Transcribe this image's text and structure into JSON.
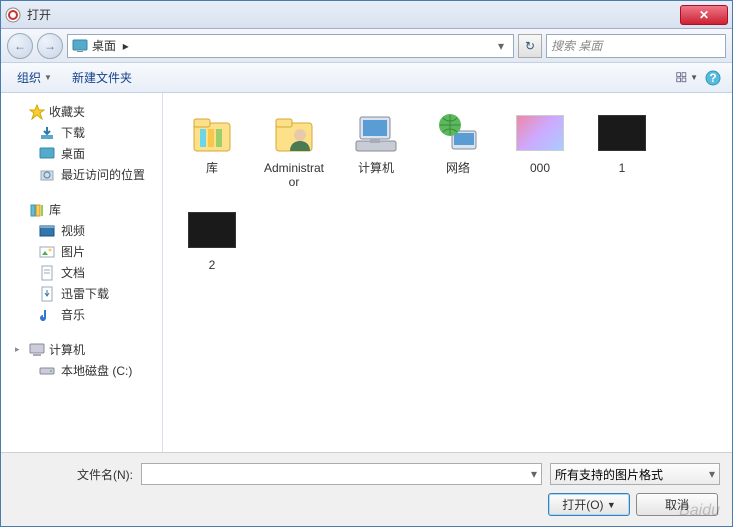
{
  "title": "打开",
  "address": {
    "location": "桌面",
    "separator": "▸"
  },
  "search": {
    "placeholder": "搜索 桌面"
  },
  "toolbar": {
    "organize": "组织",
    "newfolder": "新建文件夹"
  },
  "sidebar": {
    "favorites": {
      "label": "收藏夹",
      "items": [
        {
          "label": "下载"
        },
        {
          "label": "桌面"
        },
        {
          "label": "最近访问的位置"
        }
      ]
    },
    "libraries": {
      "label": "库",
      "items": [
        {
          "label": "视频"
        },
        {
          "label": "图片"
        },
        {
          "label": "文档"
        },
        {
          "label": "迅雷下载"
        },
        {
          "label": "音乐"
        }
      ]
    },
    "computer": {
      "label": "计算机",
      "items": [
        {
          "label": "本地磁盘 (C:)"
        }
      ]
    }
  },
  "items": [
    {
      "label": "库",
      "kind": "libraries"
    },
    {
      "label": "Administrator",
      "kind": "userfolder"
    },
    {
      "label": "计算机",
      "kind": "computer"
    },
    {
      "label": "网络",
      "kind": "network"
    },
    {
      "label": "000",
      "kind": "image"
    },
    {
      "label": "1",
      "kind": "dark"
    },
    {
      "label": "2",
      "kind": "dark"
    }
  ],
  "footer": {
    "filename_label": "文件名(N):",
    "filetype_label": "所有支持的图片格式",
    "open_btn": "打开(O)",
    "cancel_btn": "取消"
  },
  "watermark": "Baidu"
}
